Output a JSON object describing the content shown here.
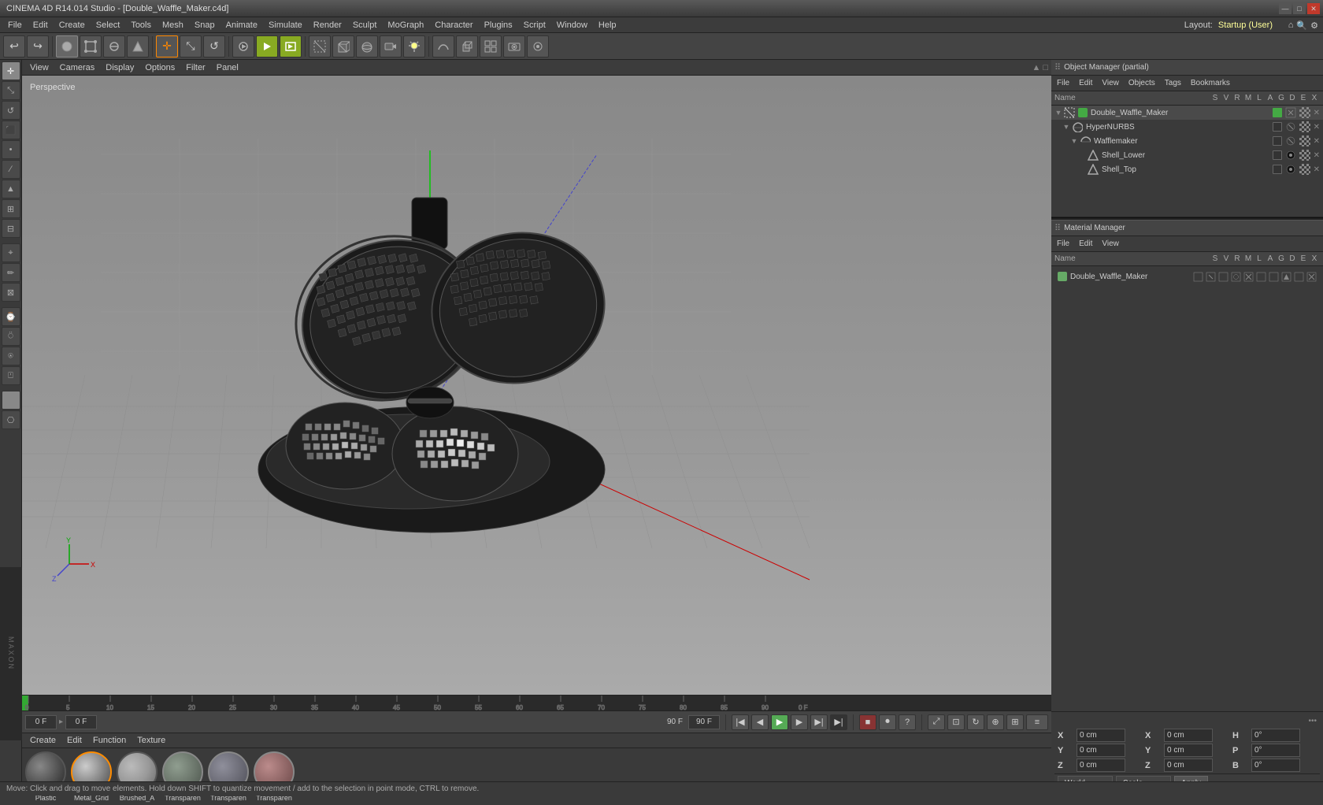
{
  "title_bar": {
    "title": "CINEMA 4D R14.014 Studio - [Double_Waffle_Maker.c4d]",
    "win_min": "—",
    "win_max": "□",
    "win_close": "✕"
  },
  "menu_bar": {
    "items": [
      "File",
      "Edit",
      "Create",
      "Select",
      "Tools",
      "Mesh",
      "Snap",
      "Animate",
      "Simulate",
      "Render",
      "Sculpt",
      "MoGraph",
      "Character",
      "Plugins",
      "Script",
      "Window",
      "Help"
    ]
  },
  "layout": {
    "label": "Layout:",
    "value": "Startup (User)"
  },
  "viewport": {
    "label": "Perspective",
    "menus": [
      "View",
      "Cameras",
      "Display",
      "Options",
      "Filter",
      "Panel"
    ]
  },
  "object_manager": {
    "title": "Object Manager",
    "menus": [
      "File",
      "Edit",
      "View",
      "Objects",
      "Tags",
      "Bookmarks"
    ],
    "header_cols": [
      "Name",
      "S",
      "V",
      "R",
      "M",
      "L",
      "A",
      "G",
      "D",
      "E",
      "X"
    ],
    "items": [
      {
        "indent": 0,
        "expand": true,
        "icon": "null-icon",
        "color": "green",
        "name": "Double_Waffle_Maker",
        "has_tag": true
      },
      {
        "indent": 1,
        "expand": true,
        "icon": "nurbs-icon",
        "color": null,
        "name": "HyperNURBS",
        "has_tag": true
      },
      {
        "indent": 2,
        "expand": true,
        "icon": "nurbs-icon",
        "color": null,
        "name": "Wafflemaker",
        "has_tag": true
      },
      {
        "indent": 3,
        "expand": false,
        "icon": "poly-icon",
        "color": null,
        "name": "Shell_Lower",
        "has_tag": true
      },
      {
        "indent": 3,
        "expand": false,
        "icon": "poly-icon",
        "color": null,
        "name": "Shell_Top",
        "has_tag": true
      }
    ]
  },
  "material_manager": {
    "title": "Material Manager",
    "menus": [
      "File",
      "Edit",
      "View"
    ],
    "header_cols": [
      "Name",
      "S",
      "V",
      "R",
      "M",
      "L",
      "A",
      "G",
      "D",
      "E",
      "X"
    ],
    "items": [
      {
        "name": "Double_Waffle_Maker",
        "color": "green"
      }
    ]
  },
  "materials": {
    "menus": [
      "Create",
      "Edit",
      "Function",
      "Texture"
    ],
    "list": [
      {
        "name": "Plastic",
        "type": "plastic",
        "selected": false
      },
      {
        "name": "Metal_Grid",
        "type": "metal",
        "selected": true
      },
      {
        "name": "Brushed_A",
        "type": "brushed",
        "selected": false
      },
      {
        "name": "Transparen",
        "type": "transparent1",
        "selected": false
      },
      {
        "name": "Transparen",
        "type": "transparent2",
        "selected": false
      },
      {
        "name": "Transparen",
        "type": "transparent3",
        "selected": false
      }
    ]
  },
  "timeline": {
    "ticks": [
      0,
      5,
      10,
      15,
      20,
      25,
      30,
      35,
      40,
      45,
      50,
      55,
      60,
      65,
      70,
      75,
      80,
      85,
      90
    ],
    "current_frame": "0 F",
    "end_frame": "90 F",
    "fps_label": "0 F",
    "fps_end": "90 F"
  },
  "playback": {
    "frame_input": "0 F",
    "frame_label": "0 F",
    "end_frame": "90 F",
    "fps": "90 F"
  },
  "coordinates": {
    "x": {
      "label": "X",
      "pos": "0 cm",
      "rot": "0 cm",
      "size_label": "H",
      "size": "0°"
    },
    "y": {
      "label": "Y",
      "pos": "0 cm",
      "rot": "0 cm",
      "size_label": "P",
      "size": "0°"
    },
    "z": {
      "label": "Z",
      "pos": "0 cm",
      "rot": "0 cm",
      "size_label": "B",
      "size": "0°"
    },
    "world_dropdown": "World",
    "scale_dropdown": "Scale",
    "apply_btn": "Apply"
  },
  "status_bar": {
    "text": "Move: Click and drag to move elements. Hold down SHIFT to quantize movement / add to the selection in point mode, CTRL to remove."
  },
  "icons": {
    "undo": "↩",
    "redo": "↪",
    "new_obj": "+",
    "cube": "⬛",
    "circle": "○",
    "xform_move": "✛",
    "xform_rot": "↺",
    "xform_scale": "⇔",
    "render": "▷",
    "render_view": "▶",
    "render_all": "◀",
    "play": "▶",
    "stop": "■",
    "prev_frame": "◀",
    "next_frame": "▶",
    "first_frame": "|◀",
    "last_frame": "▶|"
  }
}
